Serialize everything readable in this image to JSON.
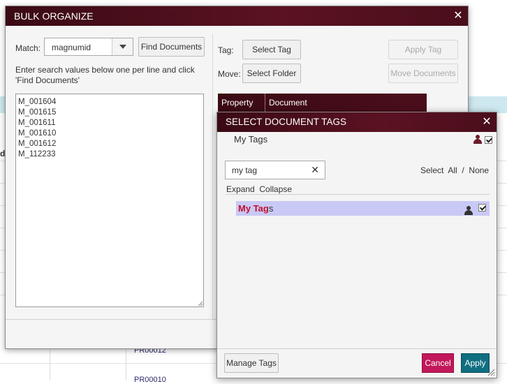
{
  "background": {
    "header_fragment": "d",
    "cell_top": "PR00012",
    "cell_bottom": "PR00010"
  },
  "bulk": {
    "title": "BULK ORGANIZE",
    "match_label": "Match:",
    "match_value": "magnumid",
    "find_button": "Find Documents",
    "instructions": "Enter search values below one per line and click 'Find Documents'",
    "search_values": "M_001604\nM_001615\nM_001611\nM_001610\nM_001612\nM_112233",
    "tag_label": "Tag:",
    "select_tag_button": "Select Tag",
    "apply_tag_button": "Apply Tag",
    "move_label": "Move:",
    "select_folder_button": "Select Folder",
    "move_documents_button": "Move Documents",
    "columns": [
      "Property",
      "Document"
    ]
  },
  "tags_dialog": {
    "title": "SELECT DOCUMENT TAGS",
    "section_label": "My Tags",
    "search_value": "my tag",
    "select_label": "Select",
    "all_label": "All",
    "slash": "/",
    "none_label": "None",
    "expand_label": "Expand",
    "collapse_label": "Collapse",
    "tag_item": {
      "match": "My Tag",
      "rest": "s",
      "checked": true
    },
    "manage_button": "Manage Tags",
    "cancel_button": "Cancel",
    "apply_button": "Apply"
  },
  "colors": {
    "titlebar": "#4a0e1b",
    "cancel": "#c2185b",
    "apply": "#0f6e80",
    "highlight_row": "#c9c9f5",
    "match_text": "#c0102a"
  },
  "icons": [
    "close-icon",
    "dropdown-arrow-icon",
    "person-icon",
    "checkbox-icon",
    "clear-icon",
    "resize-grip-icon"
  ]
}
